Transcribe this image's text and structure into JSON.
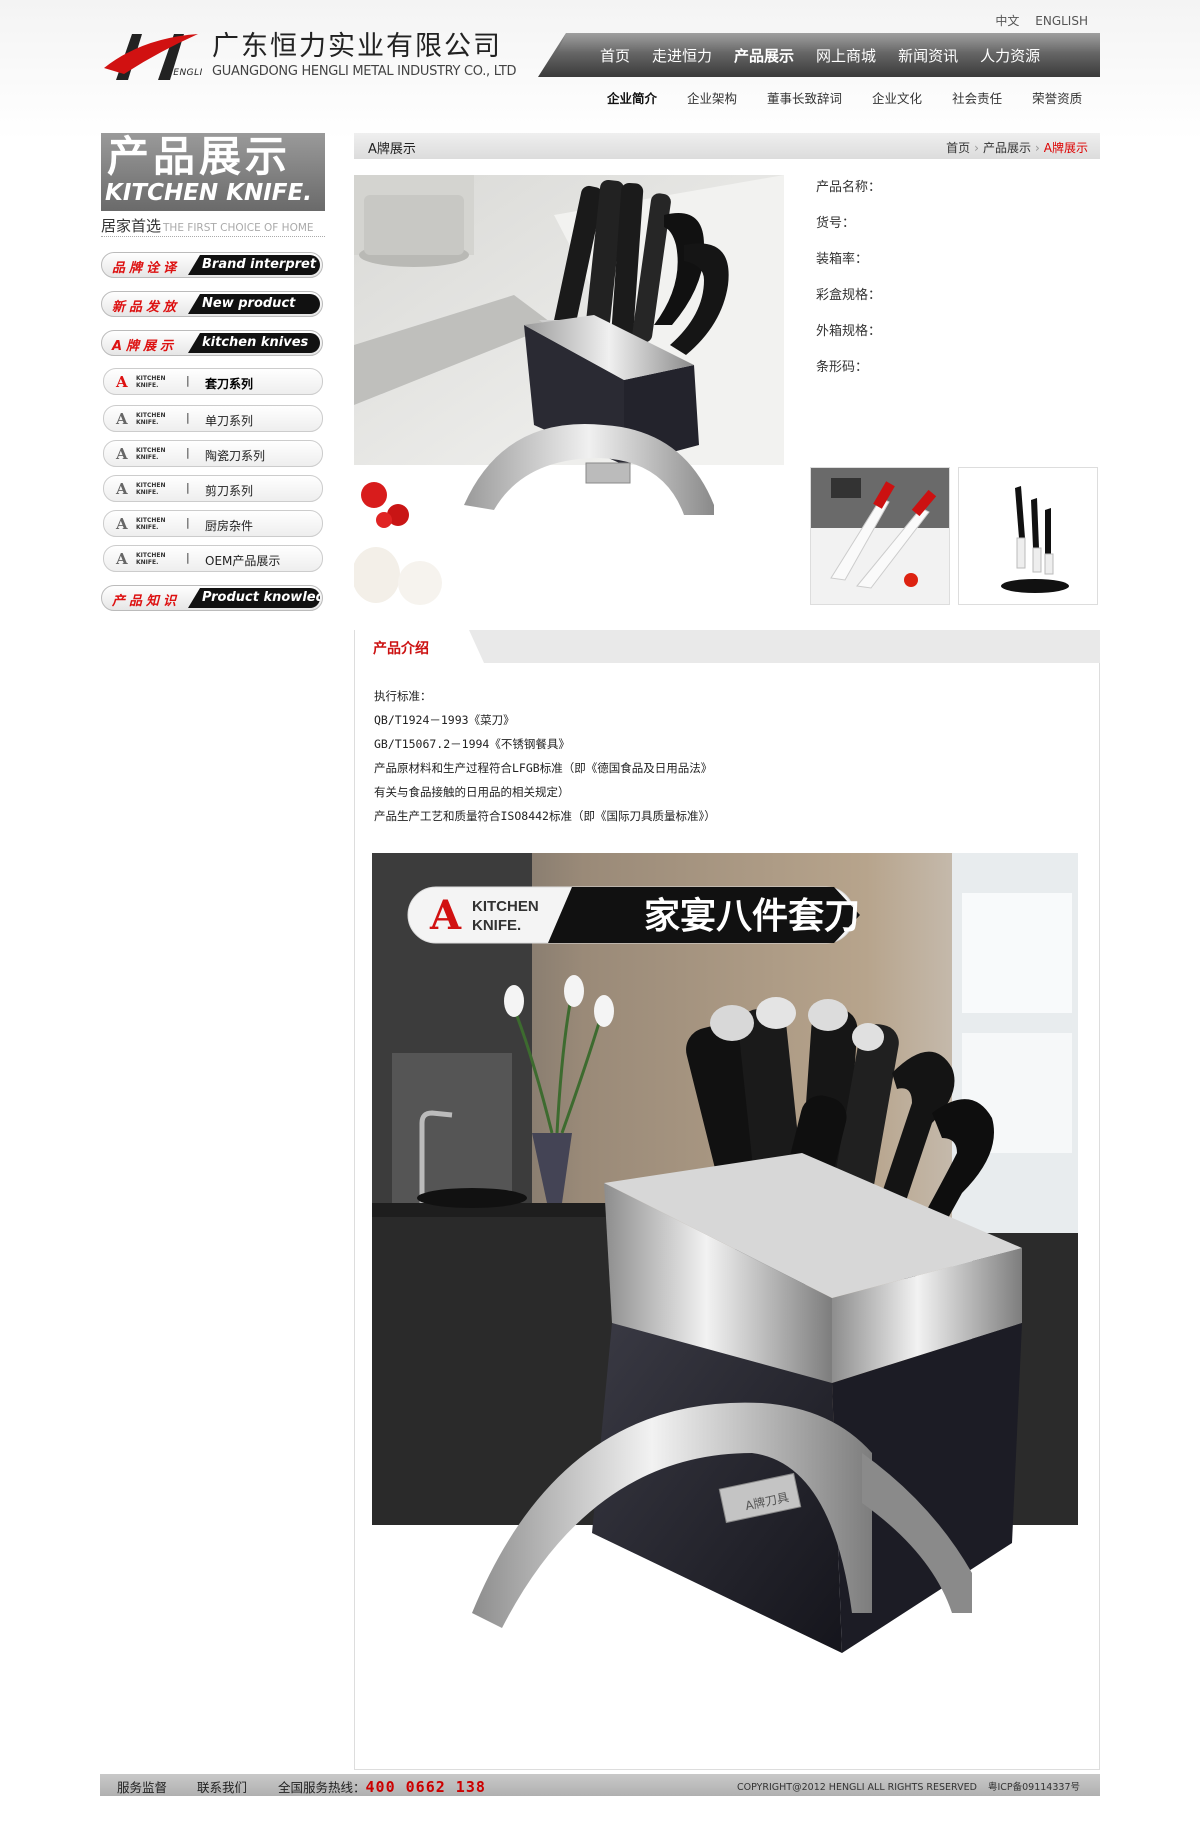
{
  "header": {
    "company_cn": "广东恒力实业有限公司",
    "company_en": "GUANGDONG HENGLI METAL INDUSTRY CO., LTD",
    "logo_text": "HENGLI",
    "lang": [
      "中文",
      "ENGLISH"
    ],
    "nav": [
      "首页",
      "走进恒力",
      "产品展示",
      "网上商城",
      "新闻资讯",
      "人力资源"
    ],
    "nav_active": "产品展示",
    "subnav": [
      "企业简介",
      "企业架构",
      "董事长致辞词",
      "企业文化",
      "社会责任",
      "荣誉资质"
    ]
  },
  "sidebar": {
    "banner_cn": "产品展示",
    "banner_en": "KITCHEN KNIFE.",
    "tag_cn": "居家首选",
    "tag_en": "THE FIRST CHOICE OF HOME",
    "main_items": [
      {
        "cn": "品牌诠译",
        "en": "Brand interpret"
      },
      {
        "cn": "新品发放",
        "en": "New product"
      },
      {
        "cn": "A牌展示",
        "en": "kitchen knives"
      },
      {
        "cn": "产品知识",
        "en": "Product knowledge"
      }
    ],
    "brand_mark": {
      "letter": "A",
      "text1": "KITCHEN",
      "text2": "KNIFE."
    },
    "sub_items": [
      "套刀系列",
      "单刀系列",
      "陶瓷刀系列",
      "剪刀系列",
      "厨房杂件",
      "OEM产品展示"
    ],
    "sub_active": "套刀系列"
  },
  "content": {
    "section_title": "A牌展示",
    "breadcrumb": [
      "首页",
      "产品展示",
      "A牌展示"
    ],
    "product_fields": [
      "产品名称：",
      "货号：",
      "装箱率：",
      "彩盒规格：",
      "外箱规格：",
      "条形码："
    ],
    "intro_title": "产品介绍",
    "intro_lines": [
      "执行标准：",
      "QB/T1924－1993《菜刀》",
      "GB/T15067.2－1994《不锈钢餐具》",
      "产品原材料和生产过程符合LFGB标准（即《德国食品及日用品法》",
      "有关与食品接触的日用品的相关规定）",
      "产品生产工艺和质量符合ISO8442标准（即《国际刀具质量标准》）"
    ],
    "banner_title": "家宴八件套刀",
    "banner_brand": [
      "KITCHEN",
      "KNIFE."
    ],
    "block_plate": "A牌刀具"
  },
  "footer": {
    "links": [
      "服务监督",
      "联系我们"
    ],
    "hotline_label": "全国服务热线：",
    "hotline": "400 0662 138",
    "copyright": "COPYRIGHT@2012 HENGLI ALL RIGHTS RESERVED",
    "icp": "粤ICP备09114337号"
  },
  "colors": {
    "accent_red": "#d11111",
    "nav_dark": "#3a3a3a"
  }
}
